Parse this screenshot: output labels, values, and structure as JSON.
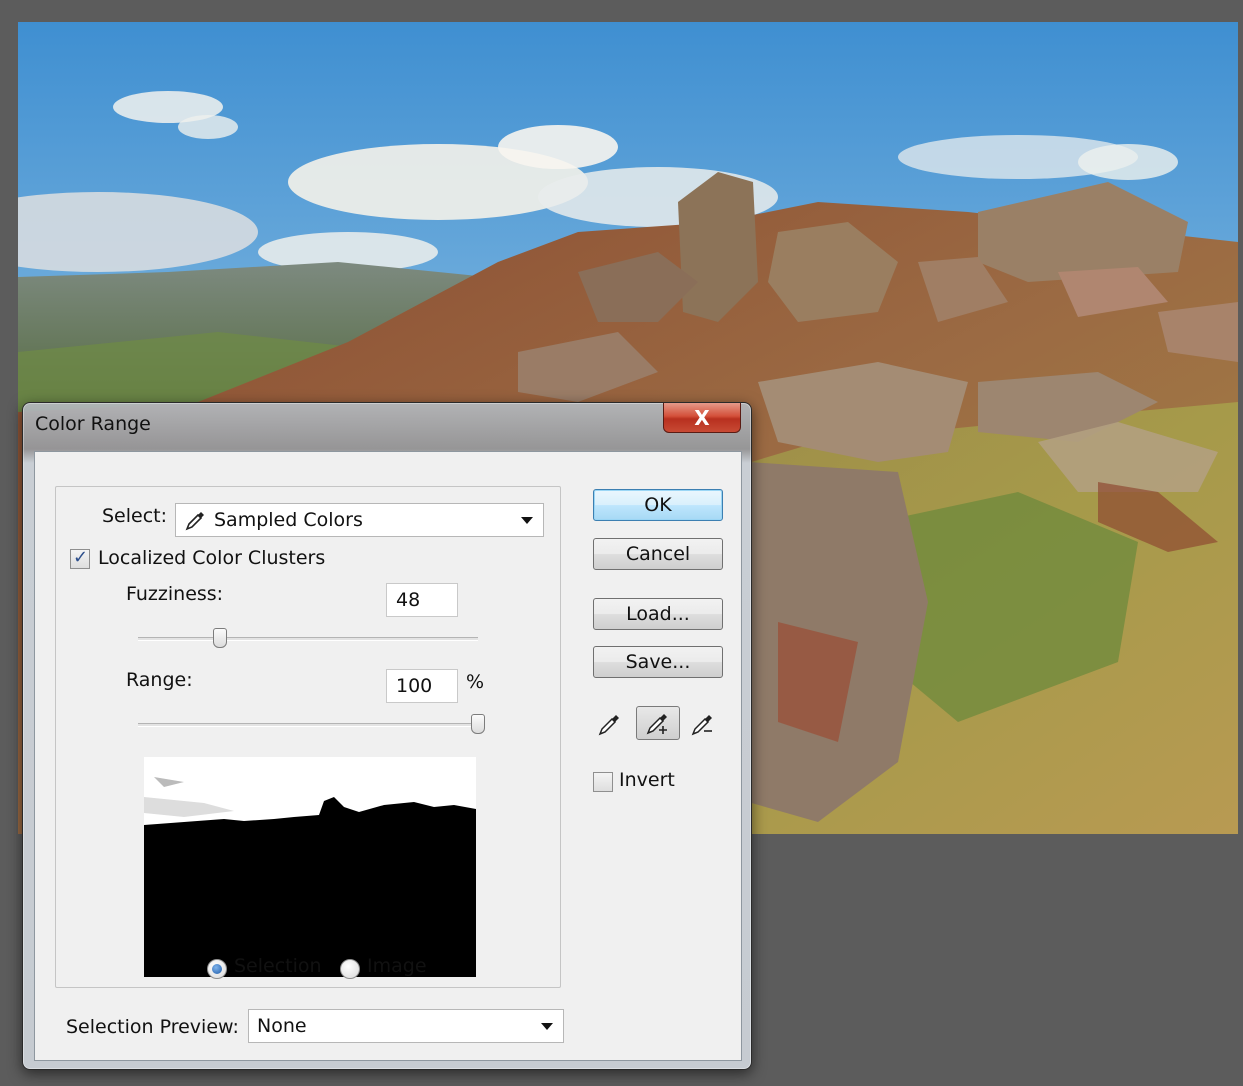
{
  "dialog": {
    "title": "Color Range",
    "close_glyph": "X",
    "select_label": "Select:",
    "select_value": "Sampled Colors",
    "localized_label": "Localized Color Clusters",
    "localized_checked": true,
    "fuzziness_label": "Fuzziness:",
    "fuzziness_value": "48",
    "range_label": "Range:",
    "range_value": "100",
    "range_unit": "%",
    "radio_selection_label": "Selection",
    "radio_image_label": "Image",
    "preview_mode": "Selection",
    "selection_preview_label": "Selection Preview:",
    "selection_preview_value": "None",
    "buttons": {
      "ok": "OK",
      "cancel": "Cancel",
      "load": "Load...",
      "save": "Save..."
    },
    "invert_label": "Invert",
    "invert_checked": false,
    "active_eyedropper": "add-to-sample"
  },
  "icons": {
    "close": "close-icon",
    "select_eyedropper": "eyedropper-icon",
    "eyedroppers": [
      "eyedropper-icon",
      "eyedropper-plus-icon",
      "eyedropper-minus-icon"
    ]
  },
  "colors": {
    "sky": "#7fb3dc",
    "close_button": "#c8402b",
    "default_button_border": "#3c7fb1",
    "canvas_background": "#5c5c5c"
  }
}
